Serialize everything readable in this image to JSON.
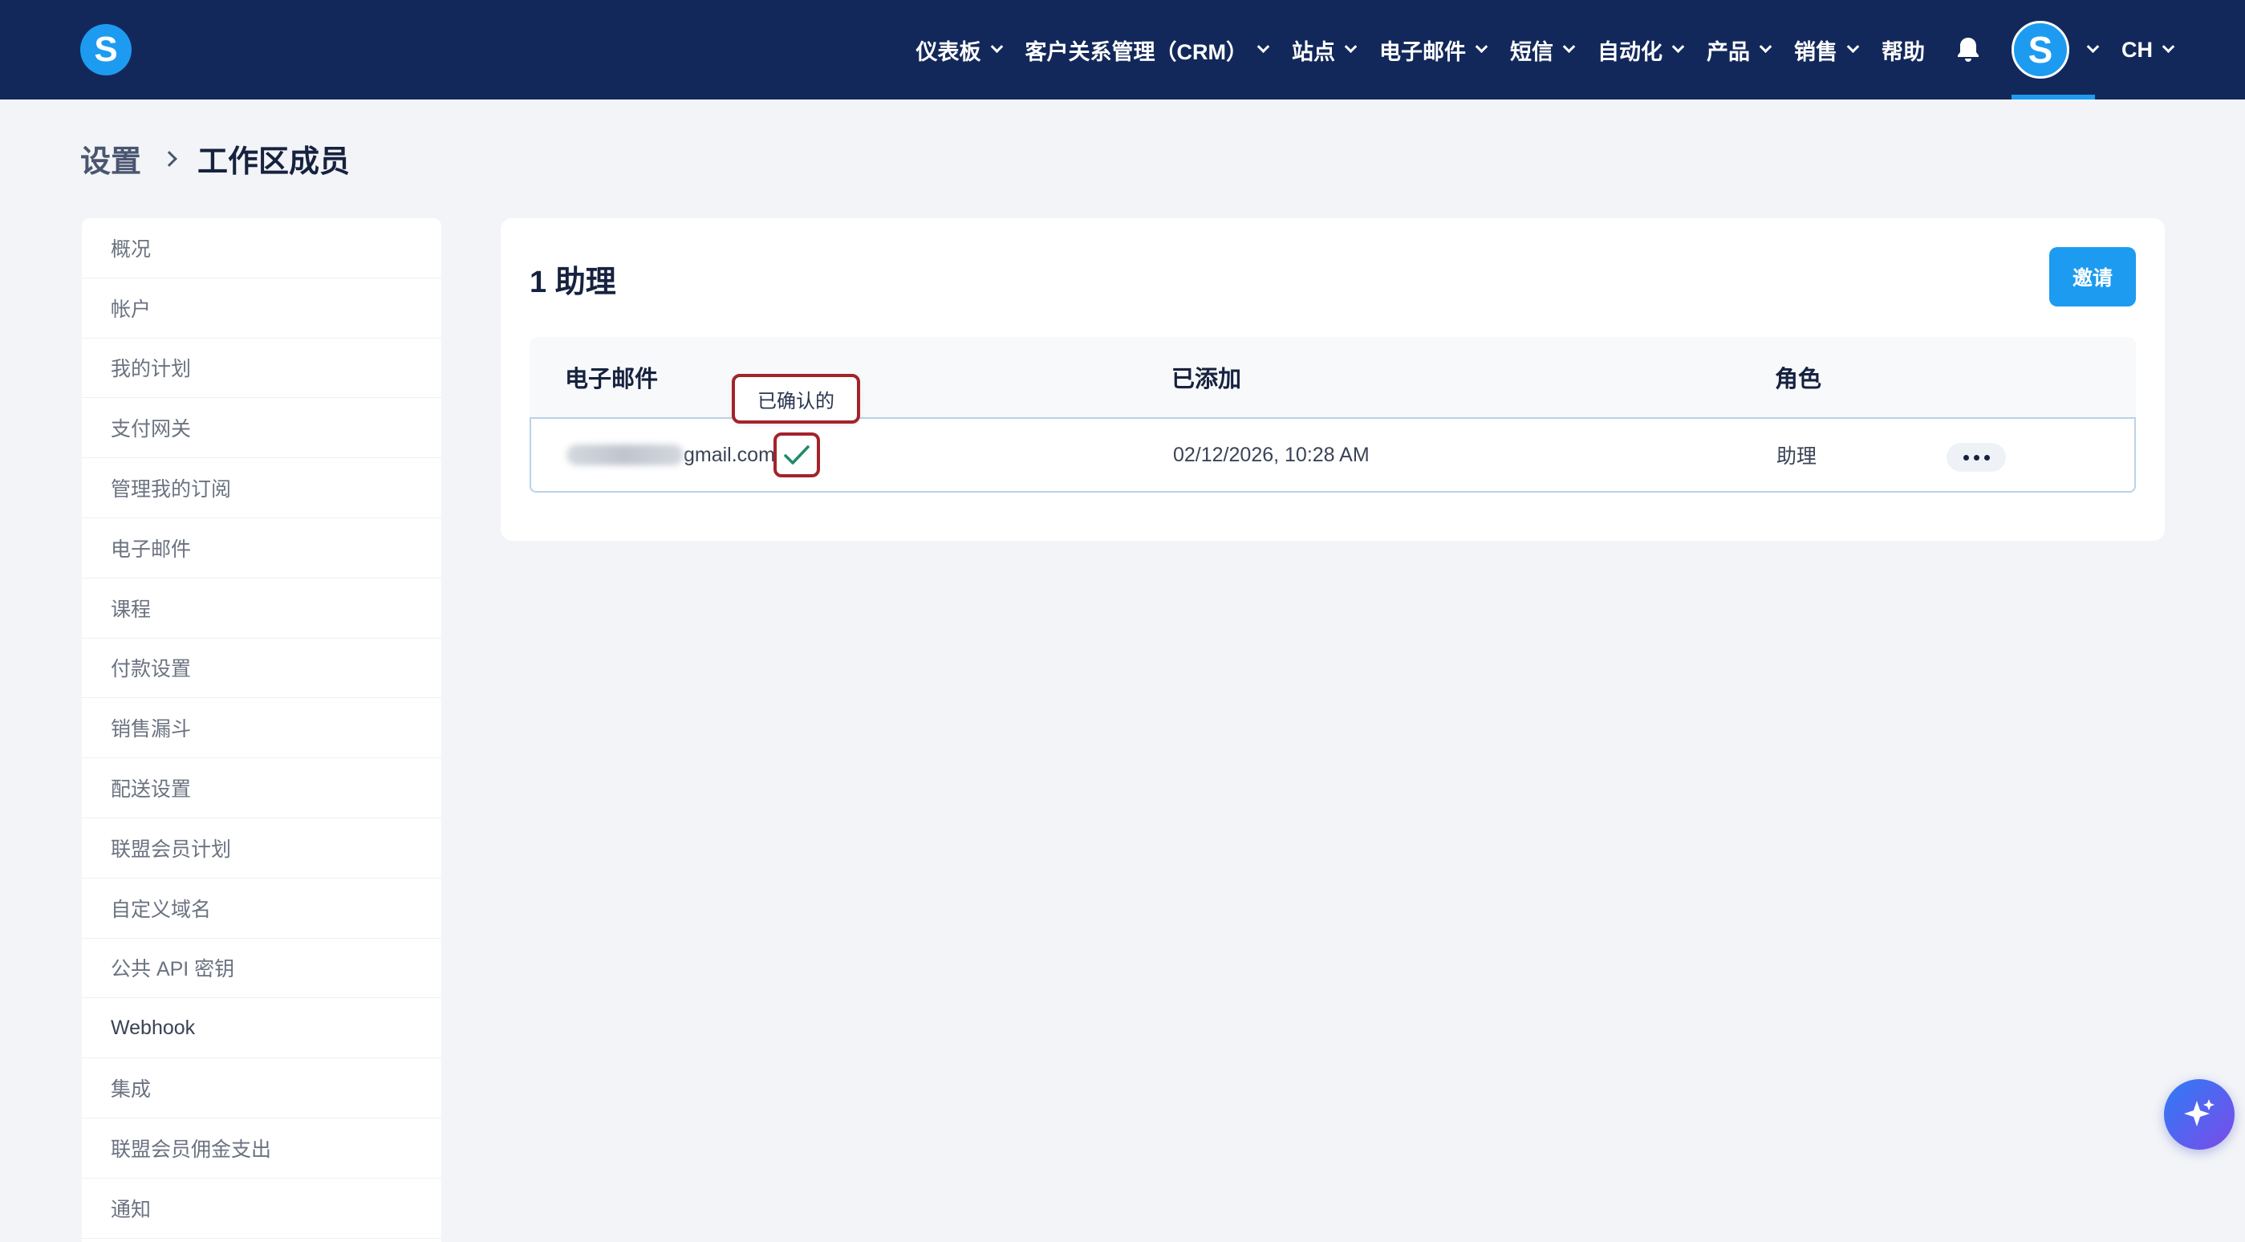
{
  "brand": {
    "logo_letter": "S"
  },
  "nav": {
    "items": [
      {
        "label": "仪表板",
        "has_dropdown": true
      },
      {
        "label": "客户关系管理（CRM）",
        "has_dropdown": true
      },
      {
        "label": "站点",
        "has_dropdown": true
      },
      {
        "label": "电子邮件",
        "has_dropdown": true
      },
      {
        "label": "短信",
        "has_dropdown": true
      },
      {
        "label": "自动化",
        "has_dropdown": true
      },
      {
        "label": "产品",
        "has_dropdown": true
      },
      {
        "label": "销售",
        "has_dropdown": true
      },
      {
        "label": "帮助",
        "has_dropdown": false
      }
    ],
    "avatar_letter": "S",
    "language": "CH",
    "icons": {
      "notifications": "bell-icon"
    }
  },
  "breadcrumb": {
    "parent": "设置",
    "current": "工作区成员"
  },
  "sidebar": {
    "items": [
      {
        "label": "概况"
      },
      {
        "label": "帐户"
      },
      {
        "label": "我的计划"
      },
      {
        "label": "支付网关"
      },
      {
        "label": "管理我的订阅"
      },
      {
        "label": "电子邮件"
      },
      {
        "label": "课程"
      },
      {
        "label": "付款设置"
      },
      {
        "label": "销售漏斗"
      },
      {
        "label": "配送设置"
      },
      {
        "label": "联盟会员计划"
      },
      {
        "label": "自定义域名"
      },
      {
        "label": "公共 API 密钥"
      },
      {
        "label": "Webhook"
      },
      {
        "label": "集成"
      },
      {
        "label": "联盟会员佣金支出"
      },
      {
        "label": "通知"
      }
    ]
  },
  "members": {
    "title": "1 助理",
    "invite_label": "邀请",
    "columns": {
      "email": "电子邮件",
      "added": "已添加",
      "role": "角色"
    },
    "rows": [
      {
        "email_domain": "gmail.com",
        "added": "02/12/2026, 10:28 AM",
        "role": "助理",
        "status_tooltip": "已确认的"
      }
    ]
  },
  "colors": {
    "nav_bg": "#13285a",
    "accent": "#1d9bf0",
    "highlight": "#a3232a",
    "check": "#1f8a6a"
  }
}
